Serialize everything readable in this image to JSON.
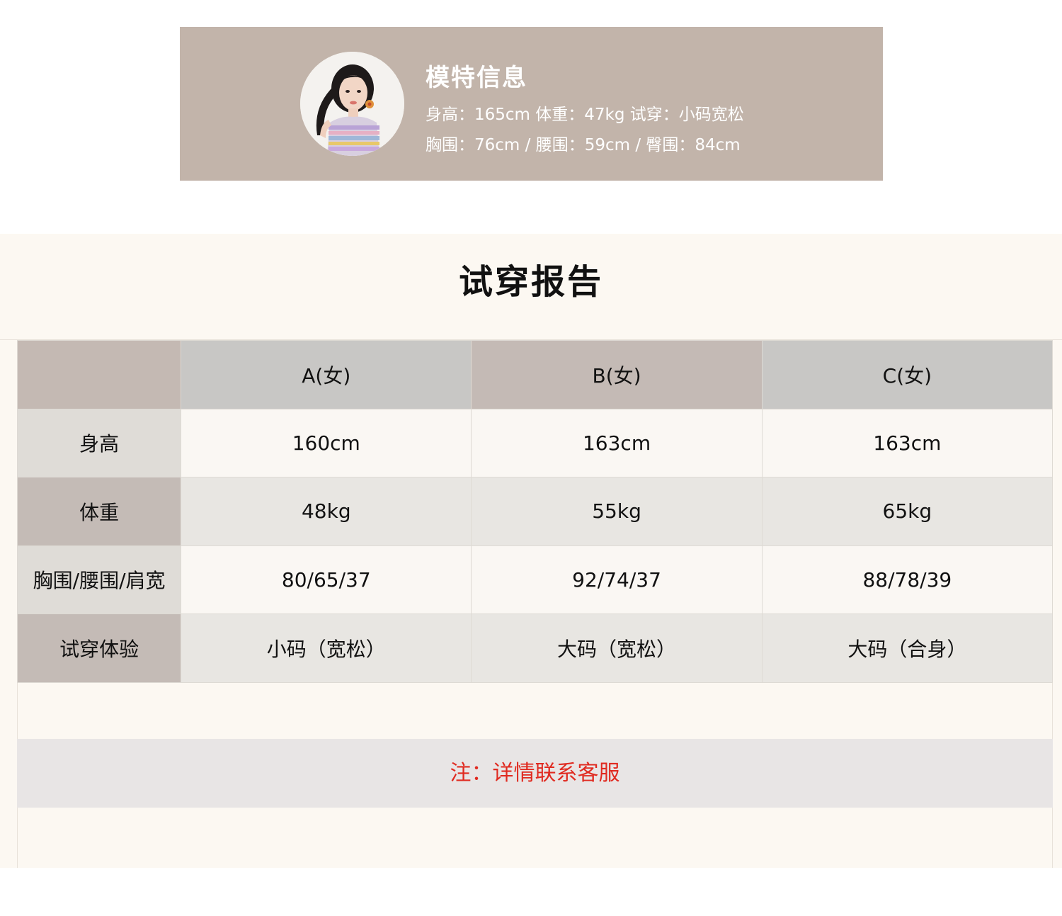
{
  "model": {
    "title": "模特信息",
    "line1": "身高：165cm  体重：47kg  试穿：小码宽松",
    "line2": "胸围：76cm / 腰围：59cm / 臀围：84cm"
  },
  "report": {
    "title": "试穿报告",
    "columns": [
      "",
      "A(女)",
      "B(女)",
      "C(女)"
    ],
    "rows": [
      {
        "label": "身高",
        "values": [
          "160cm",
          "163cm",
          "163cm"
        ]
      },
      {
        "label": "体重",
        "values": [
          "48kg",
          "55kg",
          "65kg"
        ]
      },
      {
        "label": "胸围/腰围/肩宽",
        "values": [
          "80/65/37",
          "92/74/37",
          "88/78/39"
        ]
      },
      {
        "label": "试穿体验",
        "values": [
          "小码（宽松）",
          "大码（宽松）",
          "大码（合身）"
        ]
      }
    ],
    "note": "注：详情联系客服"
  },
  "colors": {
    "card_bg": "#c2b4aa",
    "report_bg": "#fcf8f2",
    "note_text": "#e02a20"
  }
}
